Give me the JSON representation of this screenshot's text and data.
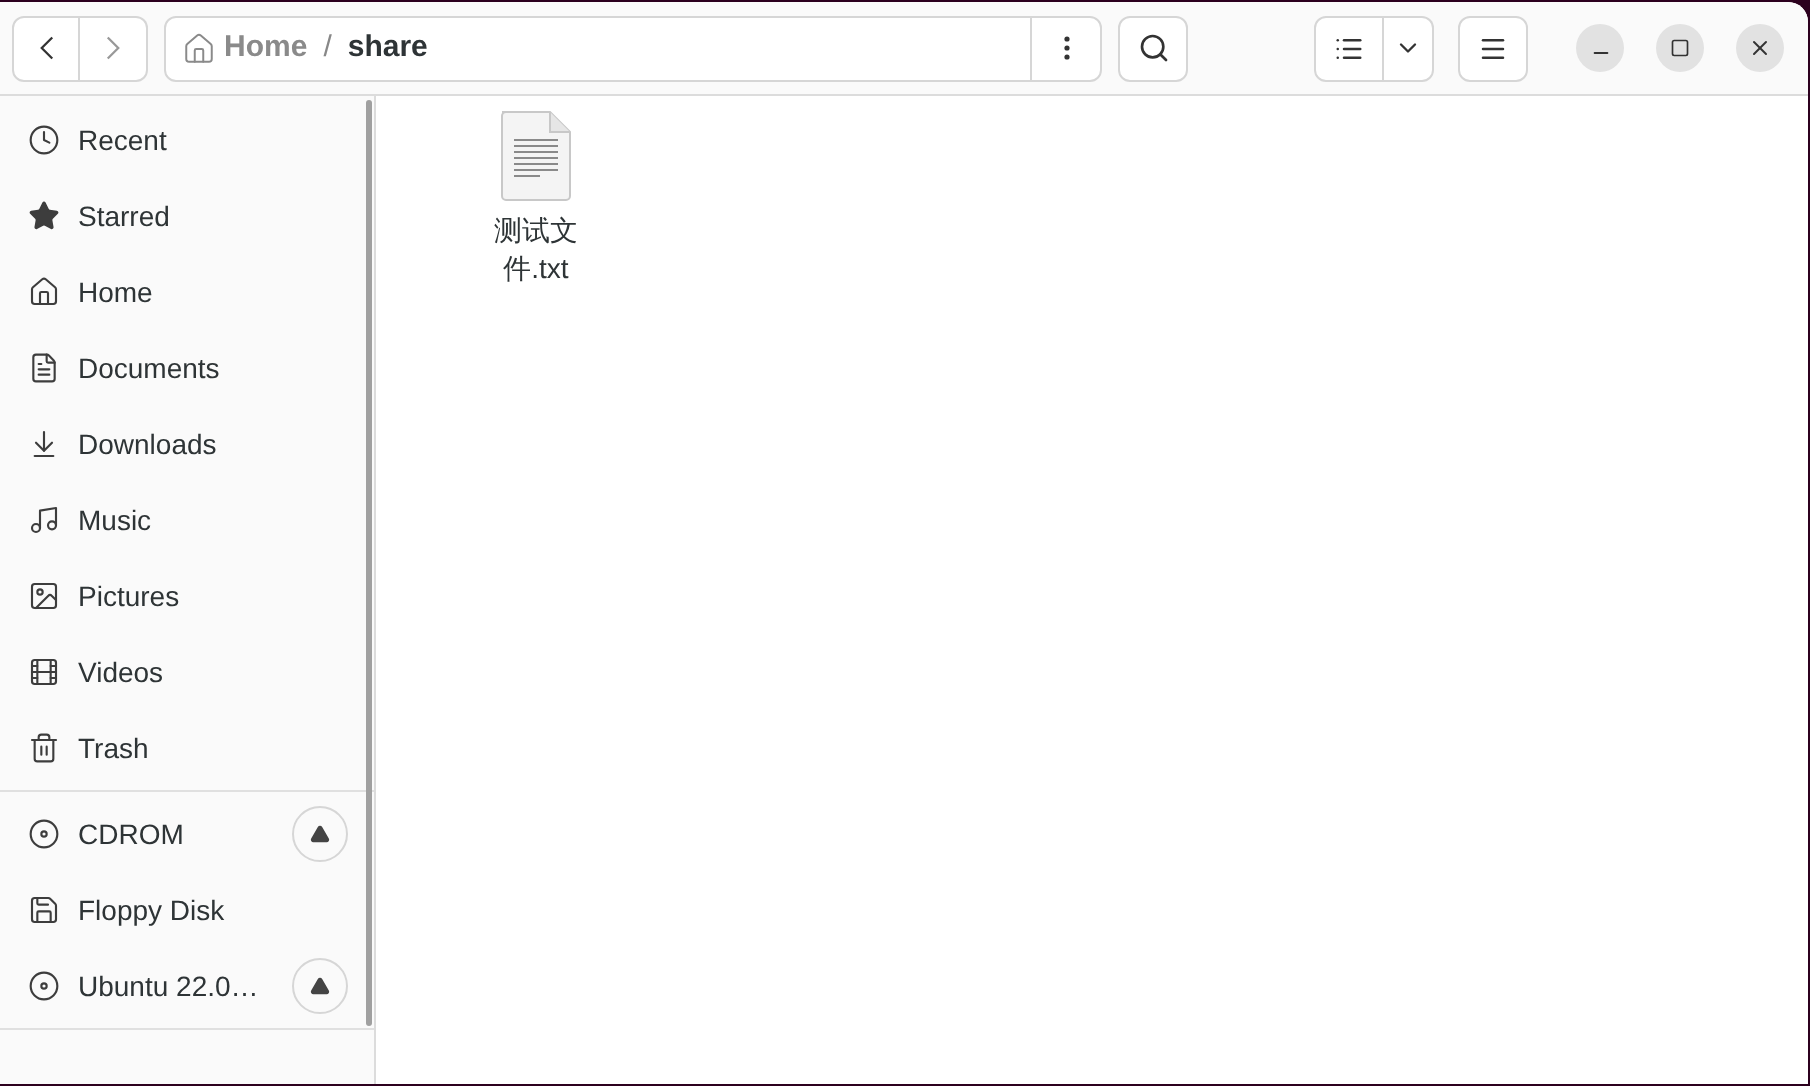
{
  "path_bar": {
    "segments": [
      {
        "label": "Home",
        "kind": "home",
        "current": false
      },
      {
        "separator": "/",
        "label": "share",
        "kind": "folder",
        "current": true
      }
    ]
  },
  "sidebar": {
    "places": [
      {
        "label": "Recent",
        "kind": "recent"
      },
      {
        "label": "Starred",
        "kind": "starred"
      },
      {
        "label": "Home",
        "kind": "home"
      },
      {
        "label": "Documents",
        "kind": "documents"
      },
      {
        "label": "Downloads",
        "kind": "downloads"
      },
      {
        "label": "Music",
        "kind": "music"
      },
      {
        "label": "Pictures",
        "kind": "pictures"
      },
      {
        "label": "Videos",
        "kind": "videos"
      },
      {
        "label": "Trash",
        "kind": "trash"
      }
    ],
    "devices": [
      {
        "label": "CDROM",
        "kind": "disc",
        "ejectable": true
      },
      {
        "label": "Floppy Disk",
        "kind": "floppy",
        "ejectable": false
      },
      {
        "label": "Ubuntu 22.0…",
        "kind": "disc",
        "ejectable": true
      }
    ]
  },
  "files": [
    {
      "name": "测试文件.txt",
      "kind": "text"
    }
  ]
}
